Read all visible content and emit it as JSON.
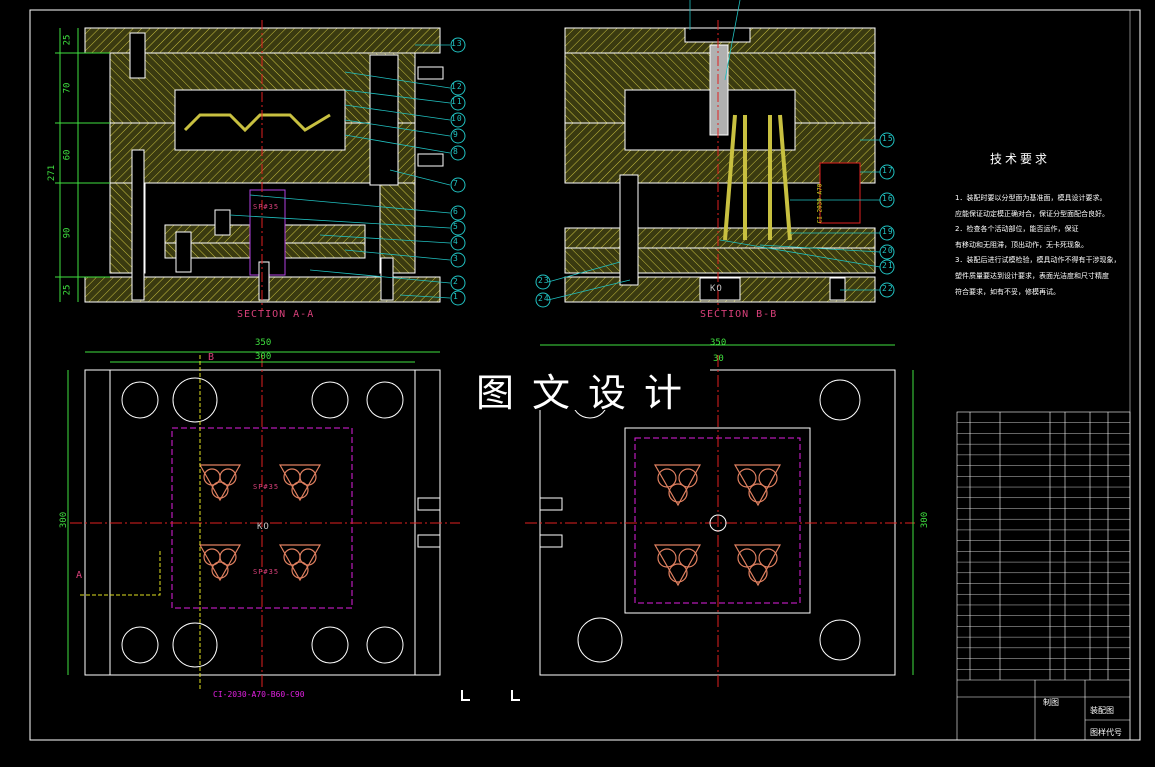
{
  "sections": {
    "a_label": "SECTION A-A",
    "b_label": "SECTION B-B"
  },
  "watermark": "图文设计",
  "technical_requirements": {
    "title": "技术要求",
    "lines": [
      "1．装配时要以分型面为基准面，模具设计要求。",
      "应能保证动定模正确对合，保证分型面配合良好。",
      "2．检查各个活动部位，能否运作，保证",
      "有移动和无阻滞，顶出动作，无卡死现象。",
      "3．装配后进行试模检验，模具动作不得有干涉现象，",
      "塑件质量要达到设计要求，表面光洁度和尺寸精度",
      "符合要求，如有不妥，修模再试。"
    ]
  },
  "dimensions": {
    "width_overall": "350",
    "width_inner": "300",
    "width_overall_b": "350",
    "width_inner_b": "30",
    "height_left": "300",
    "height_right": "300",
    "stack": [
      "25",
      "70",
      "60",
      "271",
      "90",
      "25"
    ]
  },
  "part_callouts_a": [
    "13",
    "12",
    "11",
    "10",
    "9",
    "8",
    "7",
    "6",
    "5",
    "4",
    "3",
    "2",
    "1"
  ],
  "part_callouts_b": [
    "15",
    "17",
    "16",
    "19",
    "20",
    "21",
    "22",
    "23",
    "24"
  ],
  "labels": {
    "spring_a": "SP#35",
    "spring_b": "SP#35",
    "ko_a": "KO",
    "ko_b": "KO",
    "spring_c": "SP#35",
    "section_a_mark": "A",
    "section_b_mark": "B",
    "standard_ref": "CI-2030-A70-B60-C90",
    "vertical_ref": "CI-2030-A70"
  },
  "title_block": {
    "assembly_label": "装配图",
    "drawing_no_label": "图样代号",
    "designer_label": "制图",
    "row_count": 25
  },
  "colors": {
    "background": "#000000",
    "outline": "#ffffff",
    "hatch": "#c8c040",
    "plate_fill": "#505020",
    "dimension": "#3fe03f",
    "centerline": "#e02020",
    "callout": "#20c0c0",
    "hidden": "#e020e0",
    "cavity": "#e08060"
  }
}
